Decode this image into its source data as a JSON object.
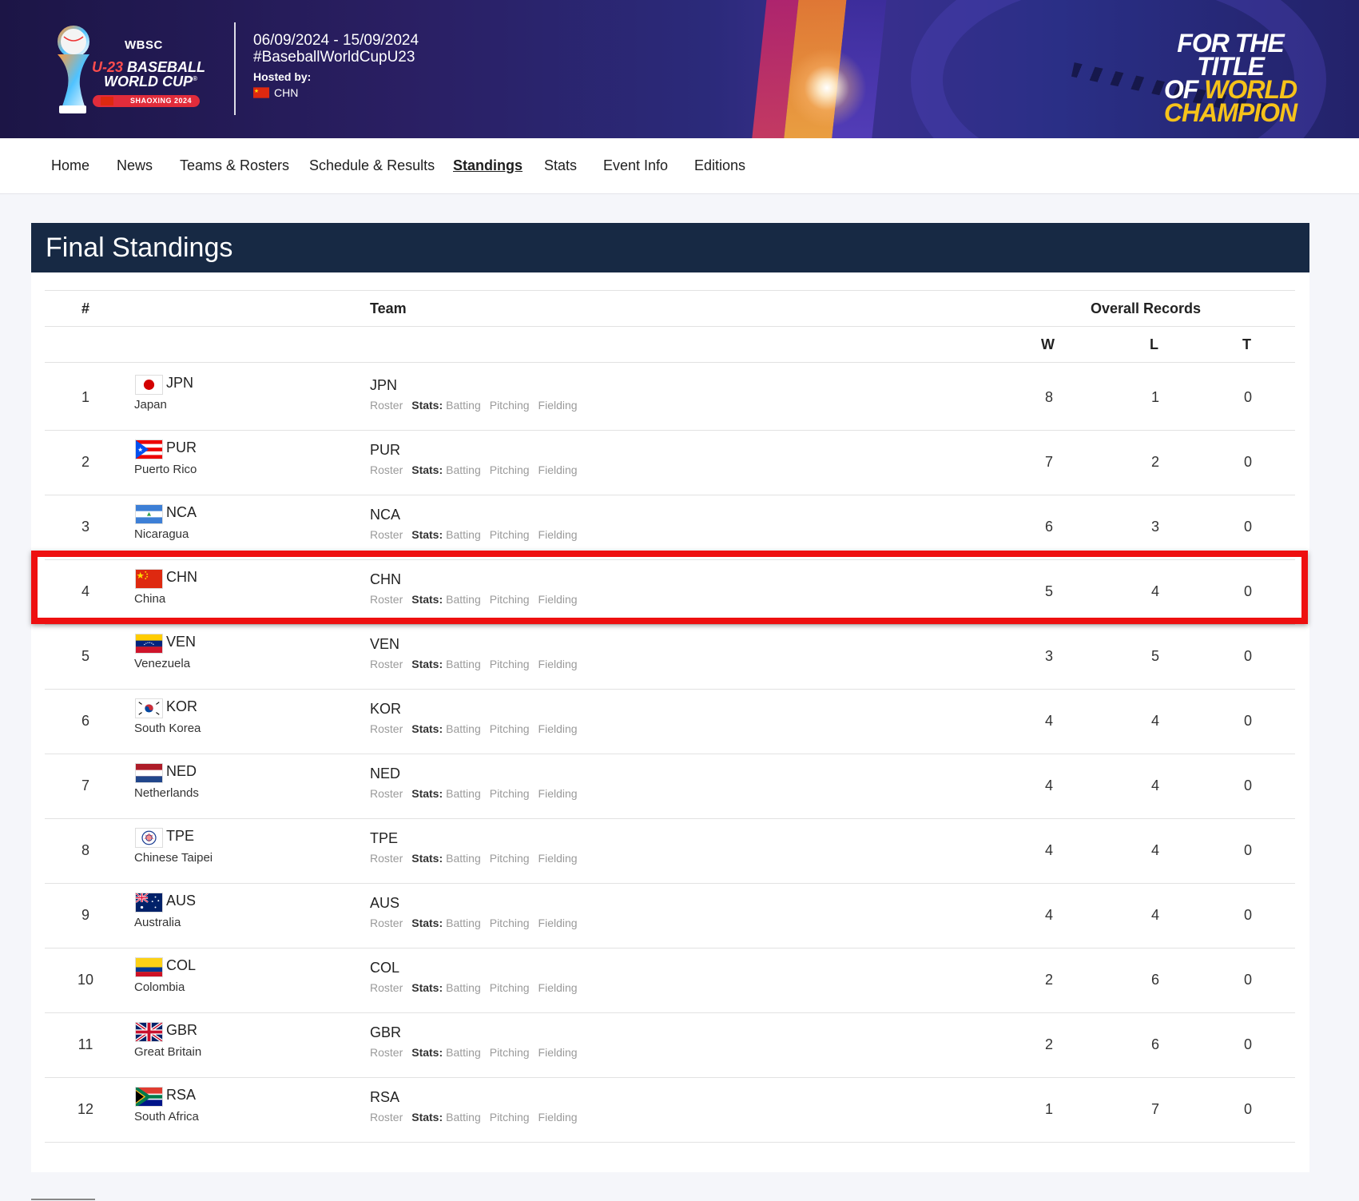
{
  "banner": {
    "logo": {
      "org": "WBSC",
      "line1_prefix": "U-23",
      "line1_rest": " BASEBALL",
      "line2": "WORLD CUP",
      "trademark": "®",
      "ribbon": "SHAOXING 2024"
    },
    "dates": "06/09/2024 - 15/09/2024",
    "hashtag": "#BaseballWorldCupU23",
    "hosted_label": "Hosted by:",
    "host_code": "CHN",
    "tagline": {
      "line1": "FOR THE TITLE",
      "line2_a": "OF ",
      "line2_b": "WORLD",
      "line3": "CHAMPION"
    }
  },
  "nav": {
    "items": [
      {
        "label": "Home",
        "active": false
      },
      {
        "label": "News",
        "active": false
      },
      {
        "label": "Teams & Rosters",
        "active": false
      },
      {
        "label": "Schedule & Results",
        "active": false
      },
      {
        "label": "Standings",
        "active": true
      },
      {
        "label": "Stats",
        "active": false
      },
      {
        "label": "Event Info",
        "active": false
      },
      {
        "label": "Editions",
        "active": false
      }
    ]
  },
  "standings": {
    "title": "Final Standings",
    "headers": {
      "rank": "#",
      "team": "Team",
      "overall": "Overall Records",
      "w": "W",
      "l": "L",
      "t": "T"
    },
    "link_labels": {
      "roster": "Roster",
      "stats": "Stats:",
      "batting": "Batting",
      "pitching": "Pitching",
      "fielding": "Fielding"
    },
    "highlighted_rank": "4",
    "highlight_color": "#ee1010",
    "rows": [
      {
        "rank": "1",
        "code": "JPN",
        "name": "Japan",
        "w": "8",
        "l": "1",
        "t": "0",
        "flag": "flag-japan"
      },
      {
        "rank": "2",
        "code": "PUR",
        "name": "Puerto Rico",
        "w": "7",
        "l": "2",
        "t": "0",
        "flag": "flag-puerto-rico"
      },
      {
        "rank": "3",
        "code": "NCA",
        "name": "Nicaragua",
        "w": "6",
        "l": "3",
        "t": "0",
        "flag": "flag-nicaragua"
      },
      {
        "rank": "4",
        "code": "CHN",
        "name": "China",
        "w": "5",
        "l": "4",
        "t": "0",
        "flag": "flag-china"
      },
      {
        "rank": "5",
        "code": "VEN",
        "name": "Venezuela",
        "w": "3",
        "l": "5",
        "t": "0",
        "flag": "flag-venezuela"
      },
      {
        "rank": "6",
        "code": "KOR",
        "name": "South Korea",
        "w": "4",
        "l": "4",
        "t": "0",
        "flag": "flag-south-korea"
      },
      {
        "rank": "7",
        "code": "NED",
        "name": "Netherlands",
        "w": "4",
        "l": "4",
        "t": "0",
        "flag": "flag-netherlands"
      },
      {
        "rank": "8",
        "code": "TPE",
        "name": "Chinese Taipei",
        "w": "4",
        "l": "4",
        "t": "0",
        "flag": "flag-chinese-taipei"
      },
      {
        "rank": "9",
        "code": "AUS",
        "name": "Australia",
        "w": "4",
        "l": "4",
        "t": "0",
        "flag": "flag-australia"
      },
      {
        "rank": "10",
        "code": "COL",
        "name": "Colombia",
        "w": "2",
        "l": "6",
        "t": "0",
        "flag": "flag-colombia"
      },
      {
        "rank": "11",
        "code": "GBR",
        "name": "Great Britain",
        "w": "2",
        "l": "6",
        "t": "0",
        "flag": "flag-great-britain"
      },
      {
        "rank": "12",
        "code": "RSA",
        "name": "South Africa",
        "w": "1",
        "l": "7",
        "t": "0",
        "flag": "flag-south-africa"
      }
    ]
  }
}
